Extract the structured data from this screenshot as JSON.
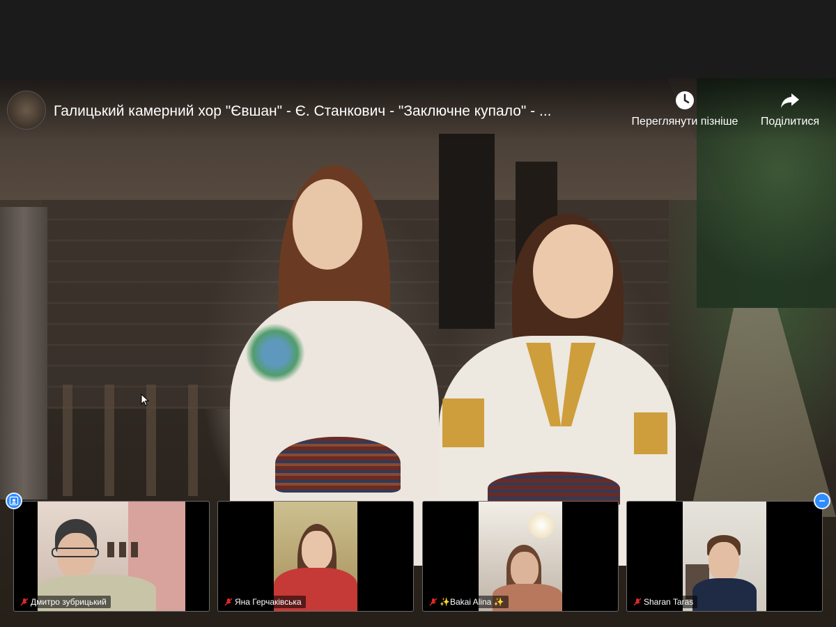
{
  "video": {
    "title": "Галицький камерний хор \"Євшан\" - Є. Станкович - \"Заключне купало\" - ...",
    "watch_later_label": "Переглянути пізніше",
    "share_label": "Поділитися"
  },
  "gallery": {
    "participants": [
      {
        "name": "Дмитро зубрицький",
        "muted": true
      },
      {
        "name": "Яна Герчаківська",
        "muted": true
      },
      {
        "name": "✨Bakai Alina ✨",
        "muted": true
      },
      {
        "name": "Sharan Taras",
        "muted": true
      }
    ]
  },
  "colors": {
    "zoom_blue": "#2d8cff",
    "muted_red": "#e02828"
  }
}
